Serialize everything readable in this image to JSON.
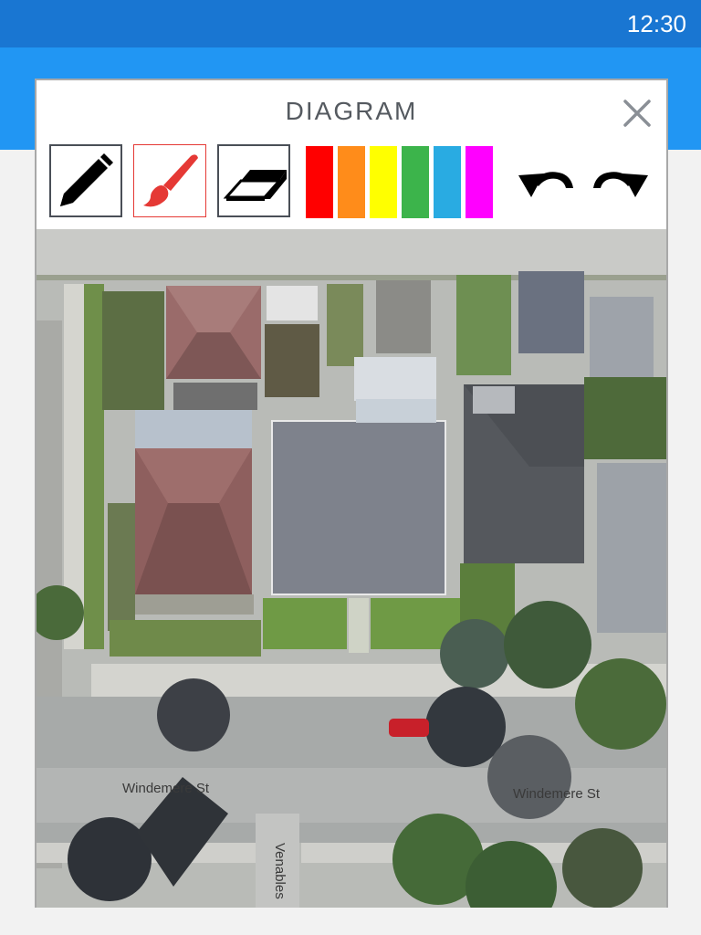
{
  "status_bar": {
    "time": "12:30"
  },
  "dialog": {
    "title": "DIAGRAM",
    "close_icon": "close-icon"
  },
  "toolbar": {
    "tools": [
      {
        "name": "pencil",
        "icon": "pencil-icon",
        "selected": false
      },
      {
        "name": "brush",
        "icon": "brush-icon",
        "selected": true
      },
      {
        "name": "eraser",
        "icon": "eraser-icon",
        "selected": false
      }
    ],
    "colors": [
      "#ff0000",
      "#ff8c1a",
      "#ffff00",
      "#3cb44b",
      "#29abe2",
      "#ff00ff"
    ],
    "undo_icon": "undo-icon",
    "redo_icon": "redo-icon"
  },
  "map": {
    "street_labels": [
      "Windemere St",
      "Windemere St",
      "Venables"
    ]
  }
}
